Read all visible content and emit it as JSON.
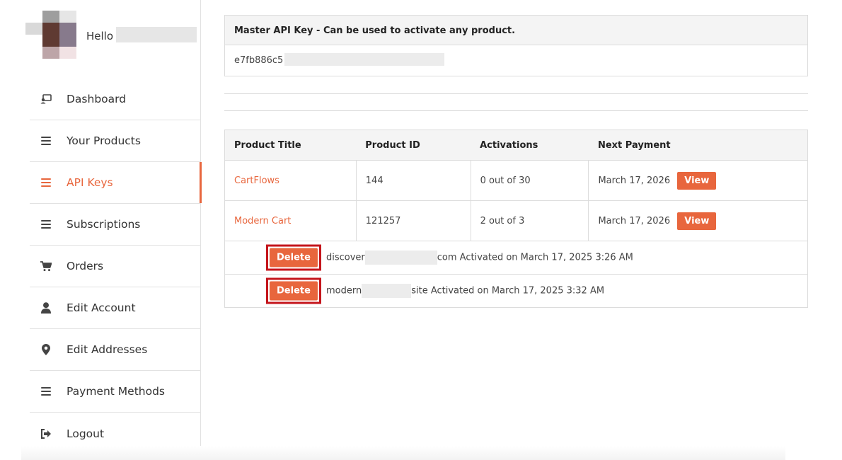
{
  "profile": {
    "greeting": "Hello"
  },
  "nav": {
    "items": [
      {
        "label": "Dashboard",
        "icon": "dashboard-icon"
      },
      {
        "label": "Your Products",
        "icon": "menu-bars-icon"
      },
      {
        "label": "API Keys",
        "icon": "menu-bars-icon",
        "active": true
      },
      {
        "label": "Subscriptions",
        "icon": "menu-bars-icon"
      },
      {
        "label": "Orders",
        "icon": "cart-icon"
      },
      {
        "label": "Edit Account",
        "icon": "user-icon"
      },
      {
        "label": "Edit Addresses",
        "icon": "location-pin-icon"
      },
      {
        "label": "Payment Methods",
        "icon": "menu-bars-icon"
      },
      {
        "label": "Logout",
        "icon": "logout-icon"
      }
    ]
  },
  "master_key": {
    "heading": "Master API Key - Can be used to activate any product.",
    "value_prefix": "e7fb886c5"
  },
  "table": {
    "headers": [
      "Product Title",
      "Product ID",
      "Activations",
      "Next Payment"
    ],
    "rows": [
      {
        "title": "CartFlows",
        "id": "144",
        "activations": "0 out of 30",
        "next_payment": "March 17, 2026",
        "action": "View"
      },
      {
        "title": "Modern Cart",
        "id": "121257",
        "activations": "2 out of 3",
        "next_payment": "March 17, 2026",
        "action": "View"
      }
    ],
    "activations": [
      {
        "button": "Delete",
        "site_prefix": "discover",
        "site_suffix": "com Activated on March 17, 2025 3:26 AM"
      },
      {
        "button": "Delete",
        "site_prefix": "modern",
        "site_suffix": "site Activated on March 17, 2025 3:32 AM"
      }
    ]
  },
  "colors": {
    "accent": "#e8663d",
    "highlight_border": "#c4151c"
  }
}
